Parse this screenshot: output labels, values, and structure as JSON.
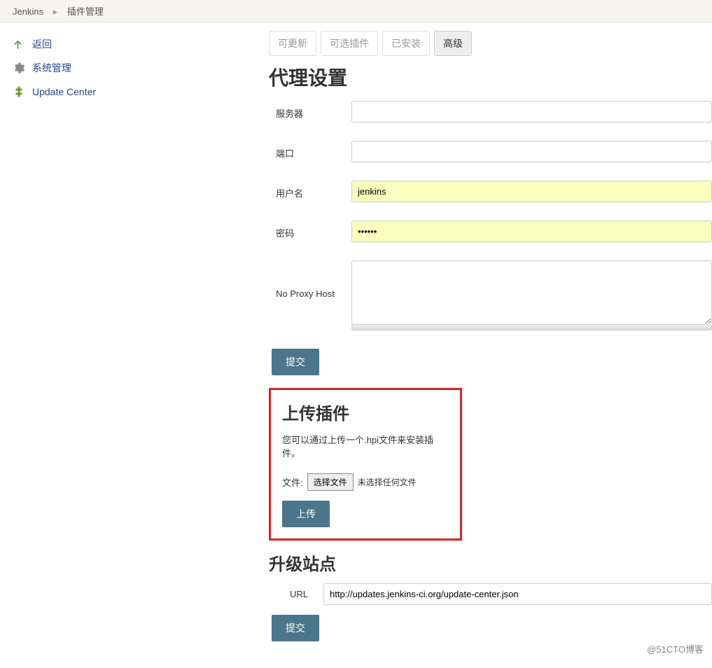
{
  "breadcrumb": {
    "root": "Jenkins",
    "current": "插件管理"
  },
  "sidebar": {
    "items": [
      {
        "label": "返回",
        "icon": "back-arrow"
      },
      {
        "label": "系统管理",
        "icon": "gear"
      },
      {
        "label": "Update Center",
        "icon": "plugin"
      }
    ]
  },
  "tabs": {
    "items": [
      {
        "label": "可更新",
        "active": false
      },
      {
        "label": "可选插件",
        "active": false
      },
      {
        "label": "已安装",
        "active": false
      },
      {
        "label": "高级",
        "active": true
      }
    ]
  },
  "proxy": {
    "title": "代理设置",
    "server_label": "服务器",
    "server_value": "",
    "port_label": "端口",
    "port_value": "",
    "user_label": "用户名",
    "user_value": "jenkins",
    "pass_label": "密码",
    "pass_value": "••••••",
    "noproxy_label": "No Proxy Host",
    "noproxy_value": "",
    "submit_label": "提交"
  },
  "upload": {
    "title": "上传插件",
    "help": "您可以通过上传一个.hpi文件来安装插件。",
    "file_label": "文件:",
    "choose_label": "选择文件",
    "status": "未选择任何文件",
    "button_label": "上传"
  },
  "site": {
    "title": "升级站点",
    "url_label": "URL",
    "url_value": "http://updates.jenkins-ci.org/update-center.json",
    "submit_label": "提交"
  },
  "watermark": "@51CTO博客"
}
